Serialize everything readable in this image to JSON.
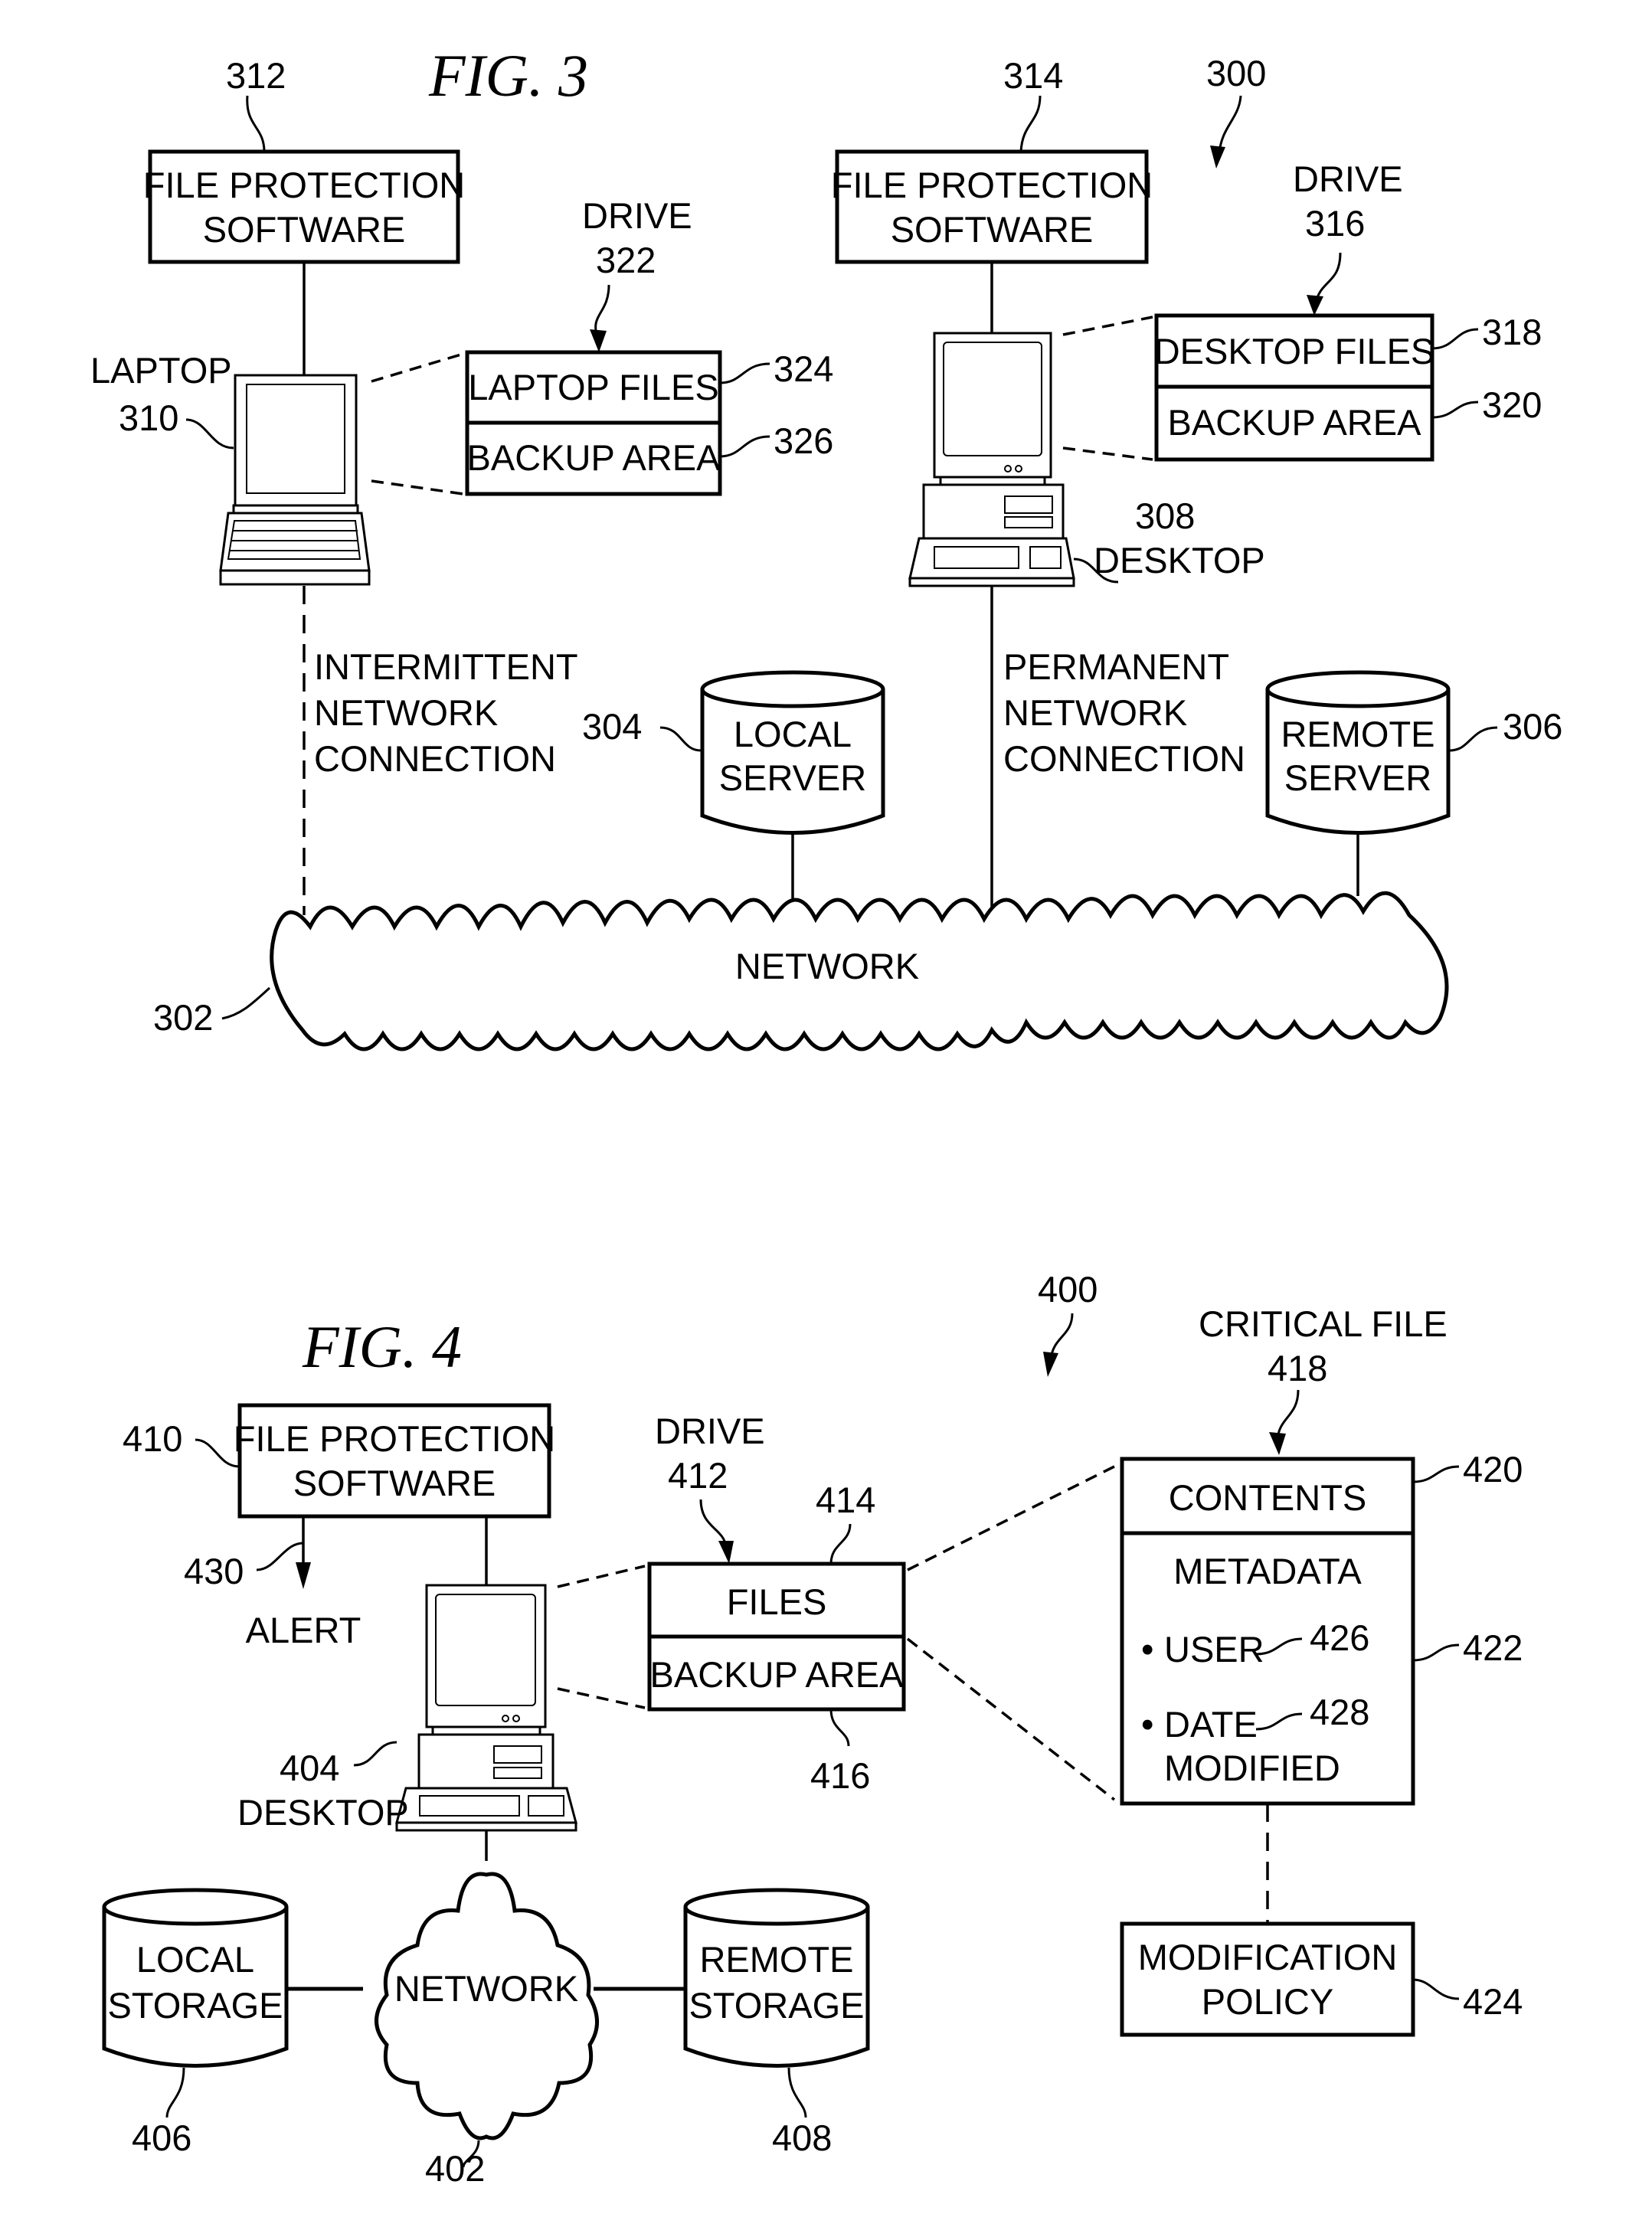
{
  "fig3": {
    "title": "FIG. 3",
    "system_ref": "300",
    "laptop_software": {
      "ref": "312",
      "line1": "FILE PROTECTION",
      "line2": "SOFTWARE"
    },
    "desktop_software": {
      "ref": "314",
      "line1": "FILE PROTECTION",
      "line2": "SOFTWARE"
    },
    "laptop": {
      "label": "LAPTOP",
      "ref": "310"
    },
    "desktop": {
      "label": "DESKTOP",
      "ref": "308"
    },
    "laptop_drive": {
      "label": "DRIVE",
      "ref": "322",
      "files": "LAPTOP FILES",
      "files_ref": "324",
      "backup": "BACKUP AREA",
      "backup_ref": "326"
    },
    "desktop_drive": {
      "label": "DRIVE",
      "ref": "316",
      "files": "DESKTOP FILES",
      "files_ref": "318",
      "backup": "BACKUP AREA",
      "backup_ref": "320"
    },
    "intermittent": {
      "line1": "INTERMITTENT",
      "line2": "NETWORK",
      "line3": "CONNECTION"
    },
    "permanent": {
      "line1": "PERMANENT",
      "line2": "NETWORK",
      "line3": "CONNECTION"
    },
    "local_server": {
      "line1": "LOCAL",
      "line2": "SERVER",
      "ref": "304"
    },
    "remote_server": {
      "line1": "REMOTE",
      "line2": "SERVER",
      "ref": "306"
    },
    "network": {
      "label": "NETWORK",
      "ref": "302"
    }
  },
  "fig4": {
    "title": "FIG. 4",
    "system_ref": "400",
    "software": {
      "ref": "410",
      "line1": "FILE PROTECTION",
      "line2": "SOFTWARE"
    },
    "alert": {
      "label": "ALERT",
      "ref": "430"
    },
    "desktop": {
      "label": "DESKTOP",
      "ref": "404"
    },
    "drive": {
      "label": "DRIVE",
      "ref": "412",
      "files": "FILES",
      "files_ref": "414",
      "backup": "BACKUP AREA",
      "backup_ref": "416"
    },
    "critical_file": {
      "label": "CRITICAL FILE",
      "ref": "418",
      "contents": "CONTENTS",
      "contents_ref": "420",
      "metadata": "METADATA",
      "metadata_ref": "422",
      "user": "USER",
      "user_ref": "426",
      "date_line1": "DATE",
      "date_line2": "MODIFIED",
      "date_ref": "428",
      "bullet": "•"
    },
    "policy": {
      "line1": "MODIFICATION",
      "line2": "POLICY",
      "ref": "424"
    },
    "local_storage": {
      "line1": "LOCAL",
      "line2": "STORAGE",
      "ref": "406"
    },
    "remote_storage": {
      "line1": "REMOTE",
      "line2": "STORAGE",
      "ref": "408"
    },
    "network": {
      "label": "NETWORK",
      "ref": "402"
    }
  }
}
